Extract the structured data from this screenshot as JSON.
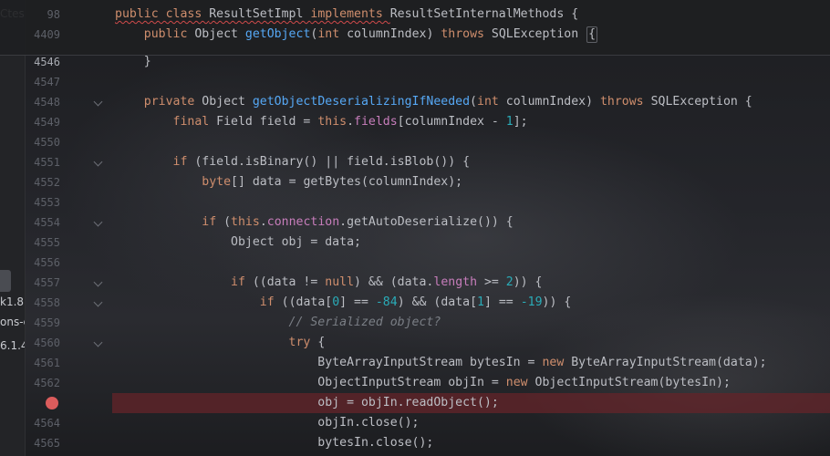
{
  "left_panel": {
    "fragments": [
      "Ctes",
      "k1.8",
      "ons-c",
      "6.1.4"
    ]
  },
  "sticky_header": [
    {
      "number": "98",
      "tokens": [
        {
          "t": "public class ",
          "c": "kw squiggle"
        },
        {
          "t": "ResultSetImpl ",
          "c": "squiggle"
        },
        {
          "t": "implements ",
          "c": "kw squiggle"
        },
        {
          "t": "ResultSetInternalMethods {",
          "c": ""
        }
      ]
    },
    {
      "number": "4409",
      "tokens": [
        {
          "t": "    public ",
          "c": "kw"
        },
        {
          "t": "Object ",
          "c": ""
        },
        {
          "t": "getObject",
          "c": "fn"
        },
        {
          "t": "(",
          "c": ""
        },
        {
          "t": "int ",
          "c": "kw"
        },
        {
          "t": "columnIndex) ",
          "c": ""
        },
        {
          "t": "throws ",
          "c": "kw"
        },
        {
          "t": "SQLException ",
          "c": ""
        },
        {
          "t": "{",
          "c": "box"
        }
      ]
    }
  ],
  "lines": [
    {
      "number": "4546",
      "current": true,
      "fold": false,
      "tokens": [
        {
          "t": "    }",
          "c": ""
        }
      ]
    },
    {
      "number": "4547",
      "fold": false,
      "tokens": []
    },
    {
      "number": "4548",
      "fold": true,
      "tokens": [
        {
          "t": "    private ",
          "c": "kw"
        },
        {
          "t": "Object ",
          "c": ""
        },
        {
          "t": "getObjectDeserializingIfNeeded",
          "c": "fn"
        },
        {
          "t": "(",
          "c": ""
        },
        {
          "t": "int ",
          "c": "kw"
        },
        {
          "t": "columnIndex) ",
          "c": ""
        },
        {
          "t": "throws ",
          "c": "kw"
        },
        {
          "t": "SQLException {",
          "c": ""
        }
      ]
    },
    {
      "number": "4549",
      "fold": false,
      "tokens": [
        {
          "t": "        final ",
          "c": "kw"
        },
        {
          "t": "Field field = ",
          "c": ""
        },
        {
          "t": "this",
          "c": "kw"
        },
        {
          "t": ".",
          "c": ""
        },
        {
          "t": "fields",
          "c": "fld"
        },
        {
          "t": "[columnIndex - ",
          "c": ""
        },
        {
          "t": "1",
          "c": "num"
        },
        {
          "t": "];",
          "c": ""
        }
      ]
    },
    {
      "number": "4550",
      "fold": false,
      "tokens": []
    },
    {
      "number": "4551",
      "fold": true,
      "tokens": [
        {
          "t": "        if ",
          "c": "kw"
        },
        {
          "t": "(field.isBinary() || field.isBlob()) {",
          "c": ""
        }
      ]
    },
    {
      "number": "4552",
      "fold": false,
      "tokens": [
        {
          "t": "            byte",
          "c": "kw"
        },
        {
          "t": "[] data = getBytes(columnIndex);",
          "c": ""
        }
      ]
    },
    {
      "number": "4553",
      "fold": false,
      "tokens": []
    },
    {
      "number": "4554",
      "fold": true,
      "tokens": [
        {
          "t": "            if ",
          "c": "kw"
        },
        {
          "t": "(",
          "c": ""
        },
        {
          "t": "this",
          "c": "kw"
        },
        {
          "t": ".",
          "c": ""
        },
        {
          "t": "connection",
          "c": "fld"
        },
        {
          "t": ".getAutoDeserialize()) {",
          "c": ""
        }
      ]
    },
    {
      "number": "4555",
      "fold": false,
      "tokens": [
        {
          "t": "                Object obj = data;",
          "c": ""
        }
      ]
    },
    {
      "number": "4556",
      "fold": false,
      "tokens": []
    },
    {
      "number": "4557",
      "fold": true,
      "tokens": [
        {
          "t": "                if ",
          "c": "kw"
        },
        {
          "t": "((data != ",
          "c": ""
        },
        {
          "t": "null",
          "c": "kw"
        },
        {
          "t": ") && (data.",
          "c": ""
        },
        {
          "t": "length",
          "c": "fld"
        },
        {
          "t": " >= ",
          "c": ""
        },
        {
          "t": "2",
          "c": "num"
        },
        {
          "t": ")) {",
          "c": ""
        }
      ]
    },
    {
      "number": "4558",
      "fold": true,
      "tokens": [
        {
          "t": "                    if ",
          "c": "kw"
        },
        {
          "t": "((data[",
          "c": ""
        },
        {
          "t": "0",
          "c": "num"
        },
        {
          "t": "] == ",
          "c": ""
        },
        {
          "t": "-84",
          "c": "num"
        },
        {
          "t": ") && (data[",
          "c": ""
        },
        {
          "t": "1",
          "c": "num"
        },
        {
          "t": "] == ",
          "c": ""
        },
        {
          "t": "-19",
          "c": "num"
        },
        {
          "t": ")) {",
          "c": ""
        }
      ]
    },
    {
      "number": "4559",
      "fold": false,
      "tokens": [
        {
          "t": "                        // Serialized object?",
          "c": "cmt"
        }
      ]
    },
    {
      "number": "4560",
      "fold": true,
      "tokens": [
        {
          "t": "                        try ",
          "c": "kw"
        },
        {
          "t": "{",
          "c": ""
        }
      ]
    },
    {
      "number": "4561",
      "fold": false,
      "tokens": [
        {
          "t": "                            ByteArrayInputStream bytesIn = ",
          "c": ""
        },
        {
          "t": "new ",
          "c": "kw"
        },
        {
          "t": "ByteArrayInputStream(data);",
          "c": ""
        }
      ]
    },
    {
      "number": "4562",
      "fold": false,
      "tokens": [
        {
          "t": "                            ObjectInputStream objIn = ",
          "c": ""
        },
        {
          "t": "new ",
          "c": "kw"
        },
        {
          "t": "ObjectInputStream(bytesIn);",
          "c": ""
        }
      ]
    },
    {
      "number": "",
      "fold": false,
      "breakpoint": true,
      "tokens": [
        {
          "t": "                            obj = objIn.readObject();",
          "c": ""
        }
      ]
    },
    {
      "number": "4564",
      "fold": false,
      "tokens": [
        {
          "t": "                            objIn.close();",
          "c": ""
        }
      ]
    },
    {
      "number": "4565",
      "fold": false,
      "tokens": [
        {
          "t": "                            bytesIn.close();",
          "c": ""
        }
      ]
    }
  ]
}
